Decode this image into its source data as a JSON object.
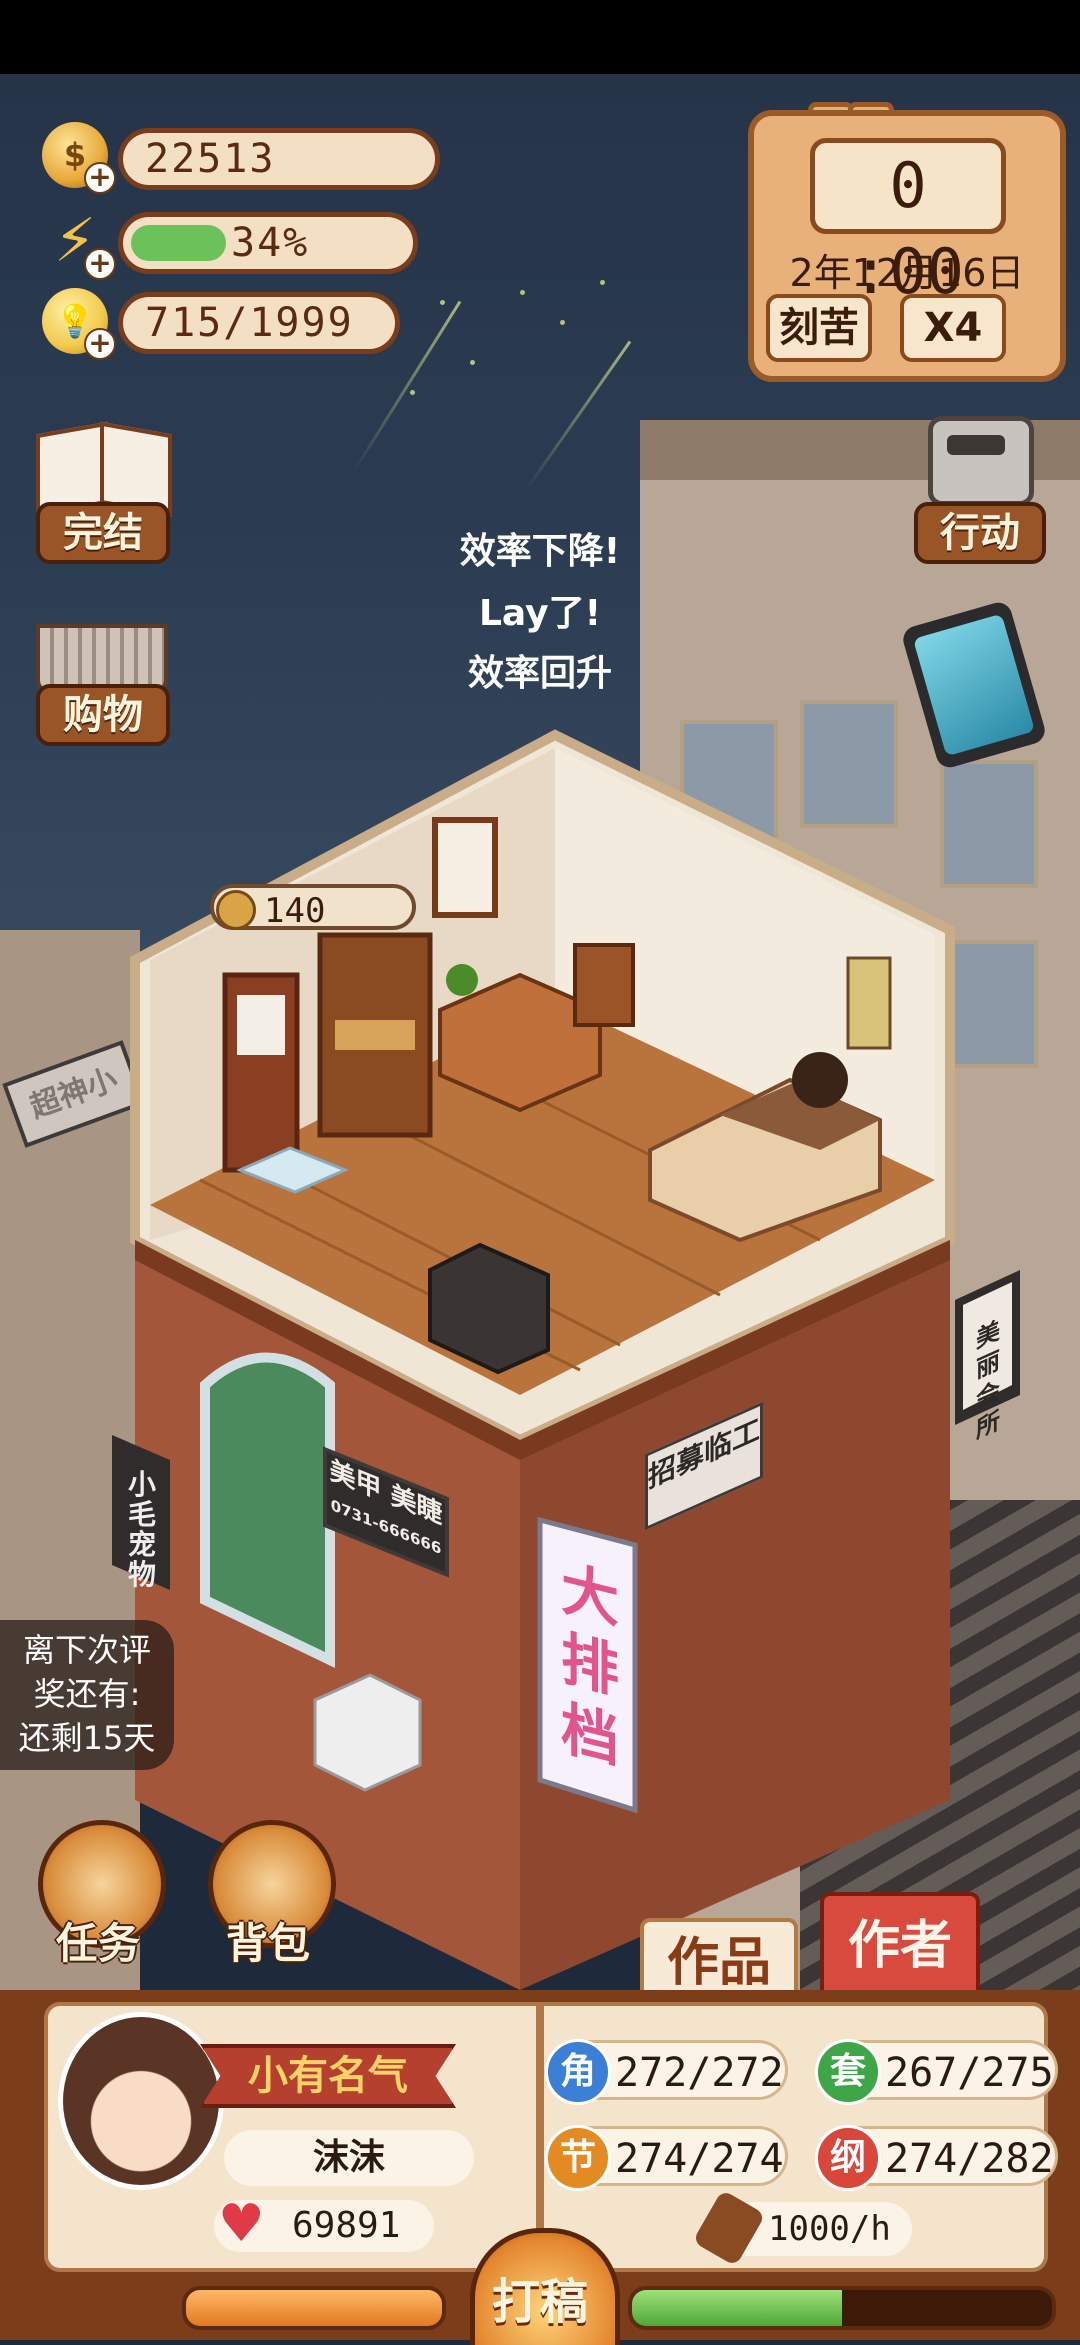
{
  "resources": {
    "coins": "22513",
    "energy_text": "34%",
    "energy_fraction": 0.34,
    "inspiration": "715/1999"
  },
  "clock": {
    "time": "0 :00",
    "date": "2年12月16日",
    "mode_label": "刻苦",
    "speed_label": "X4"
  },
  "left_menu": {
    "finish_label": "完结",
    "shop_label": "购物"
  },
  "right_menu": {
    "action_label": "行动"
  },
  "float_messages": [
    "效率下降!",
    "Lay了!",
    "效率回升"
  ],
  "room": {
    "coin_bubble": "140"
  },
  "signs": {
    "left_vertical": "小毛宠物",
    "nail": "美甲 美睫",
    "nail_phone": "0731-666666",
    "recruit": "招募临工",
    "banner": "大排档",
    "beauty": "美丽会所",
    "distant": "超神小"
  },
  "reward": {
    "line1": "离下次评",
    "line2": "奖还有:",
    "line3": "还剩15天"
  },
  "bottom_buttons": {
    "task_label": "任务",
    "bag_label": "背包"
  },
  "tabs": {
    "works_label": "作品",
    "author_label": "作者"
  },
  "profile": {
    "title": "小有名气",
    "name": "沫沫",
    "likes": "69891"
  },
  "stats": [
    {
      "icon": "角",
      "value": "272/272",
      "color": "#3b7fd6"
    },
    {
      "icon": "套",
      "value": "267/275",
      "color": "#3fa648"
    },
    {
      "icon": "节",
      "value": "274/274",
      "color": "#e48a22"
    },
    {
      "icon": "纲",
      "value": "274/282",
      "color": "#d9473a"
    }
  ],
  "production": {
    "rate": "1000/h"
  },
  "draft_button": {
    "label": "打稿"
  },
  "progress": {
    "left_fraction": 1.0,
    "right_fraction": 0.5
  }
}
